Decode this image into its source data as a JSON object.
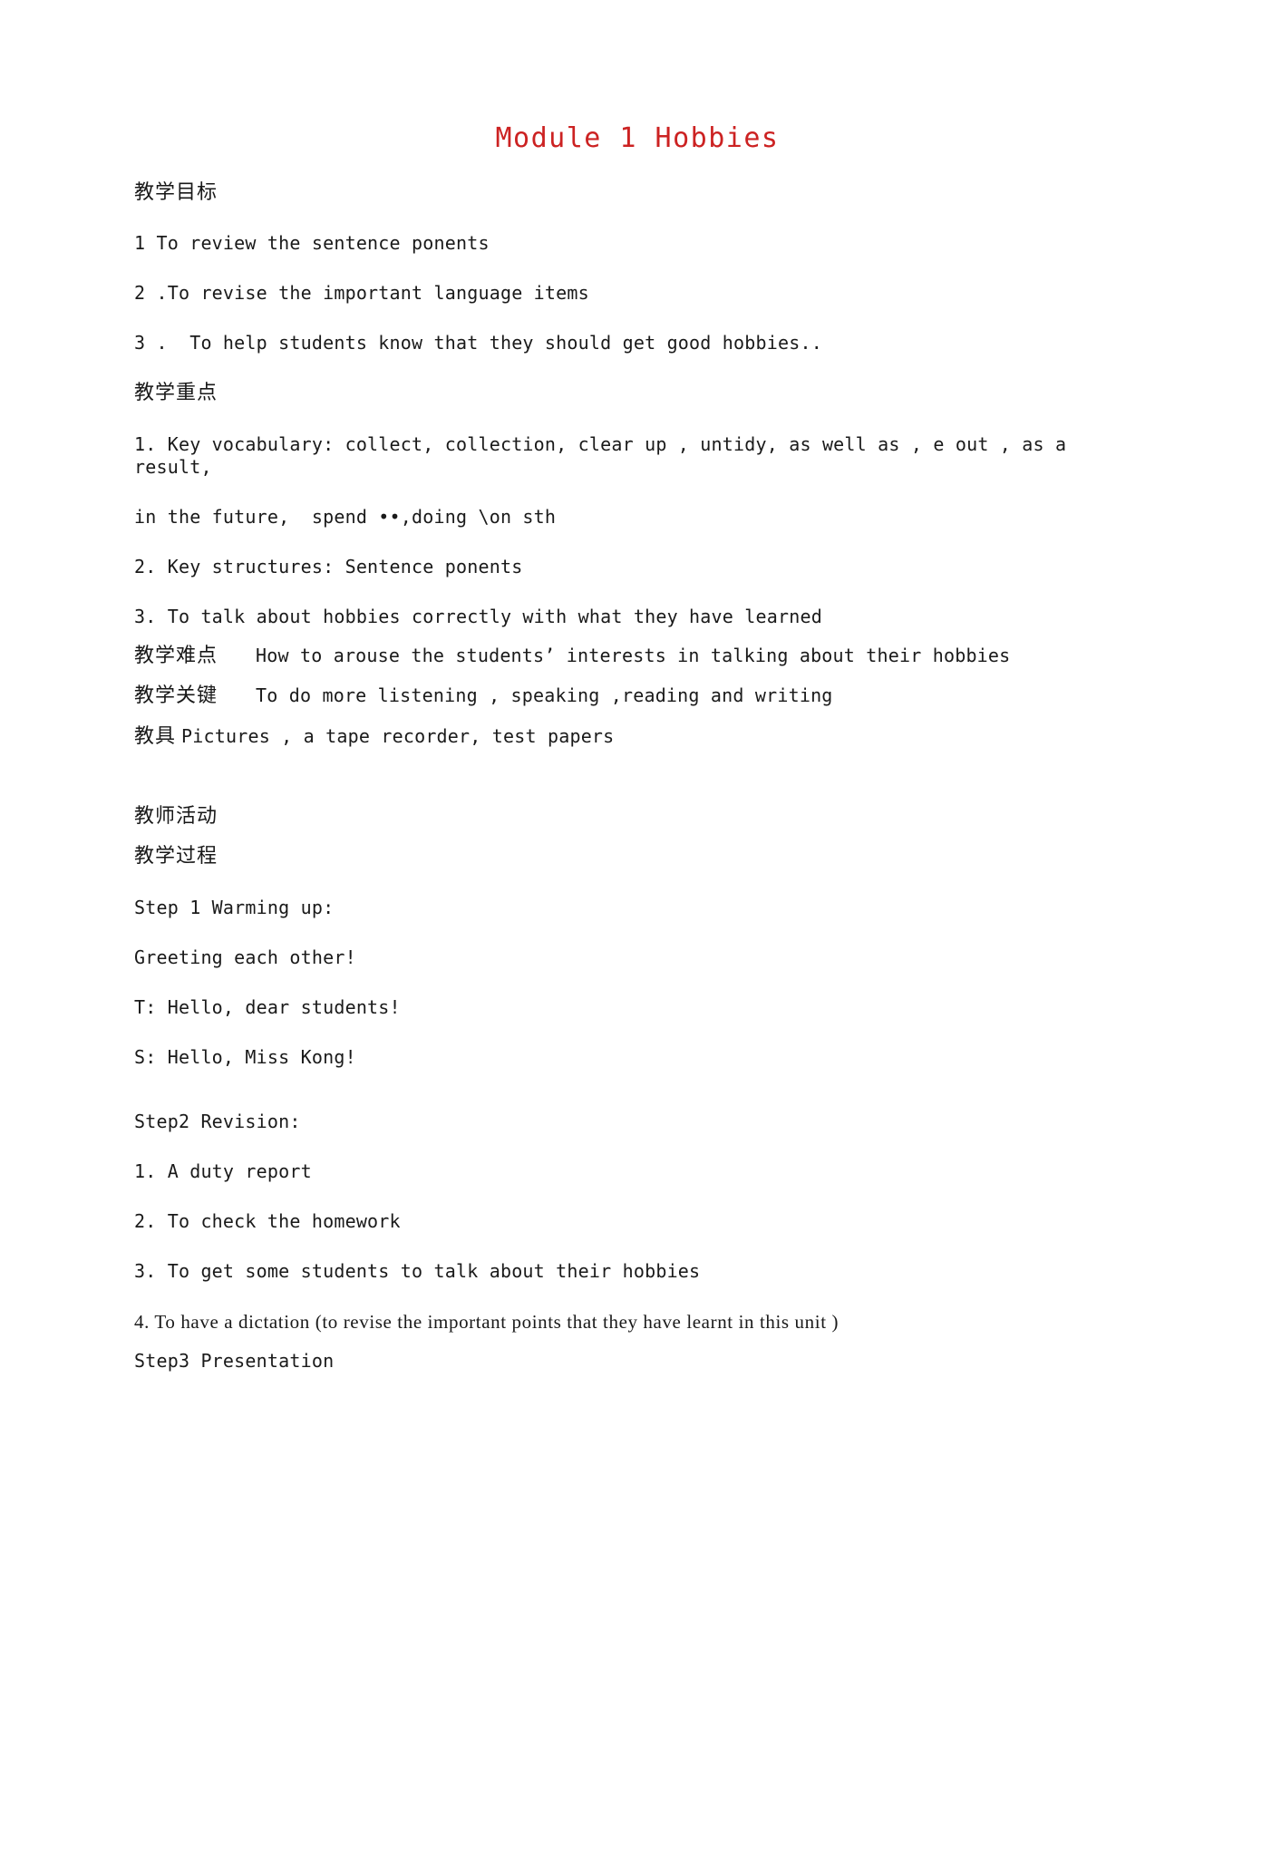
{
  "document": {
    "title": "Module 1 Hobbies",
    "title_color": "#cc2222",
    "sections": {
      "objectives_heading": "教学目标",
      "objectives": [
        "1 To review the sentence ponents",
        "2 .To revise the important language items",
        "3 .  To help students know that they should get good hobbies.."
      ],
      "key_points_heading": "教学重点",
      "key_points": [
        "1. Key vocabulary: collect, collection, clear up , untidy, as well as , e out , as a result,",
        "in the future,  spend ••,doing \\on sth",
        "2. Key structures: Sentence ponents",
        "3. To talk about hobbies correctly with what they have learned"
      ],
      "difficulty_label": "教学难点",
      "difficulty_text": "How to arouse the students’ interests in talking about their hobbies",
      "key_label": "教学关键",
      "key_text": "To do more listening , speaking ,reading and writing",
      "aids_label": "教具",
      "aids_text": "Pictures , a tape recorder, test papers",
      "teacher_activity_heading": "教师活动",
      "process_heading": "教学过程",
      "step1_title": "Step 1 Warming up:",
      "step1_lines": [
        "Greeting each other!",
        "T: Hello, dear students!",
        "S: Hello, Miss Kong!"
      ],
      "step2_title": "Step2 Revision:",
      "step2_items": [
        "1. A duty report",
        "2. To check the homework",
        "3. To get some students to talk about their hobbies",
        "4. To have a dictation (to revise the important points that they have learnt in this unit )"
      ],
      "step3_title": "Step3 Presentation"
    }
  }
}
